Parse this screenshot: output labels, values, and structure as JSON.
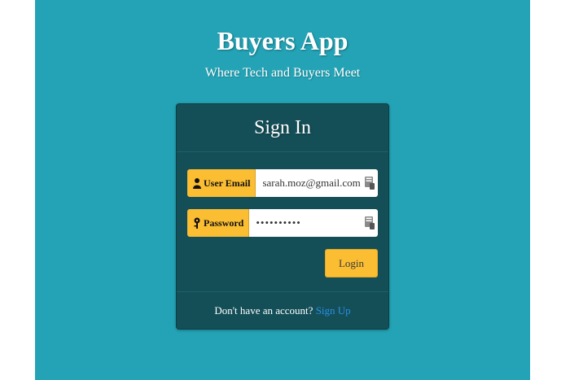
{
  "app": {
    "title": "Buyers App",
    "subtitle": "Where Tech and Buyers Meet"
  },
  "card": {
    "heading": "Sign In",
    "email": {
      "label": "User Email",
      "value": "sarah.moz@gmail.com",
      "icon": "user-icon"
    },
    "password": {
      "label": "Password",
      "value": "••••••••••",
      "icon": "key-icon"
    },
    "login_label": "Login",
    "footer_text": "Don't have an account?",
    "signup_link": "Sign Up"
  },
  "colors": {
    "page_bg": "#23a3b5",
    "card_bg": "#144f58",
    "accent": "#fbbd32",
    "link": "#2a8ee6"
  }
}
